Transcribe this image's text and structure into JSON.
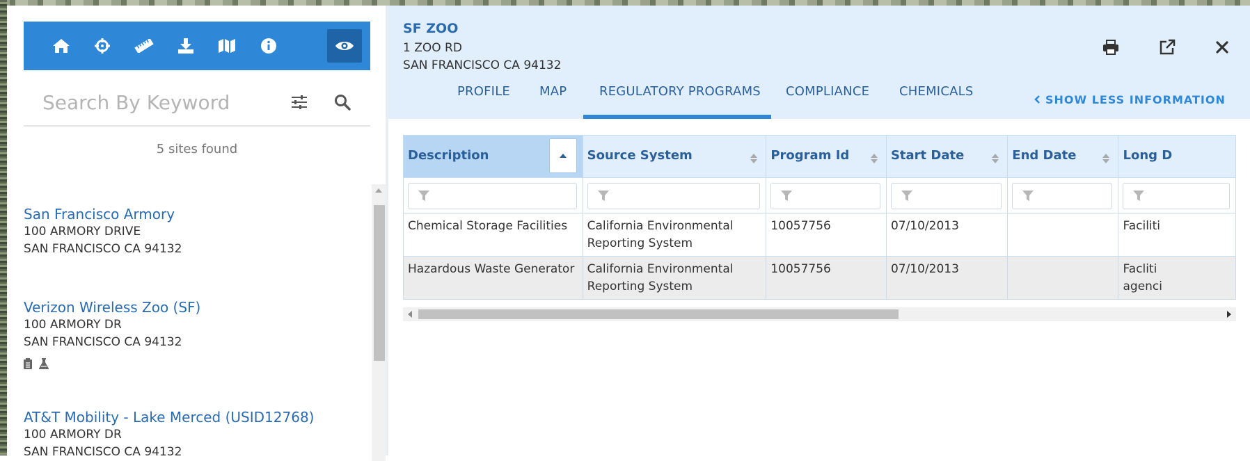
{
  "search": {
    "placeholder": "Search By Keyword"
  },
  "results": {
    "count_text": "5 sites found"
  },
  "sites": [
    {
      "name": "San Francisco Armory",
      "address1": "100 ARMORY DRIVE",
      "address2": "SAN FRANCISCO CA 94132"
    },
    {
      "name": "Verizon Wireless Zoo (SF)",
      "address1": "100 ARMORY DR",
      "address2": "SAN FRANCISCO CA 94132",
      "icons": [
        "clipboard-icon",
        "flask-icon"
      ]
    },
    {
      "name": "AT&T Mobility - Lake Merced (USID12768)",
      "address1": "100 ARMORY DR",
      "address2": "SAN FRANCISCO CA 94132"
    }
  ],
  "toolbar": {
    "icons": [
      "home-icon",
      "crosshair-icon",
      "ruler-icon",
      "download-icon",
      "map-icon",
      "info-icon",
      "eye-icon"
    ]
  },
  "detail": {
    "title": "SF ZOO",
    "address1": "1 ZOO RD",
    "address2": "SAN FRANCISCO CA 94132",
    "tabs": [
      "PROFILE",
      "MAP",
      "REGULATORY PROGRAMS",
      "COMPLIANCE",
      "CHEMICALS"
    ],
    "active_tab": "REGULATORY PROGRAMS",
    "show_less": "SHOW LESS INFORMATION",
    "header_icons": [
      "print-icon",
      "external-link-icon",
      "close-icon"
    ]
  },
  "table": {
    "columns": [
      "Description",
      "Source System",
      "Program Id",
      "Start Date",
      "End Date",
      "Long D"
    ],
    "rows": [
      [
        "Chemical Storage Facilities",
        "California Environmental Reporting System",
        "10057756",
        "07/10/2013",
        "",
        "Faciliti"
      ],
      [
        "Hazardous Waste Generator",
        "California Environmental Reporting System",
        "10057756",
        "07/10/2013",
        "",
        "Facliti agenci"
      ]
    ]
  },
  "colors": {
    "toolbar": "#2f87d8",
    "accent": "#2a6bb0",
    "header_bg": "#e1eefb"
  }
}
